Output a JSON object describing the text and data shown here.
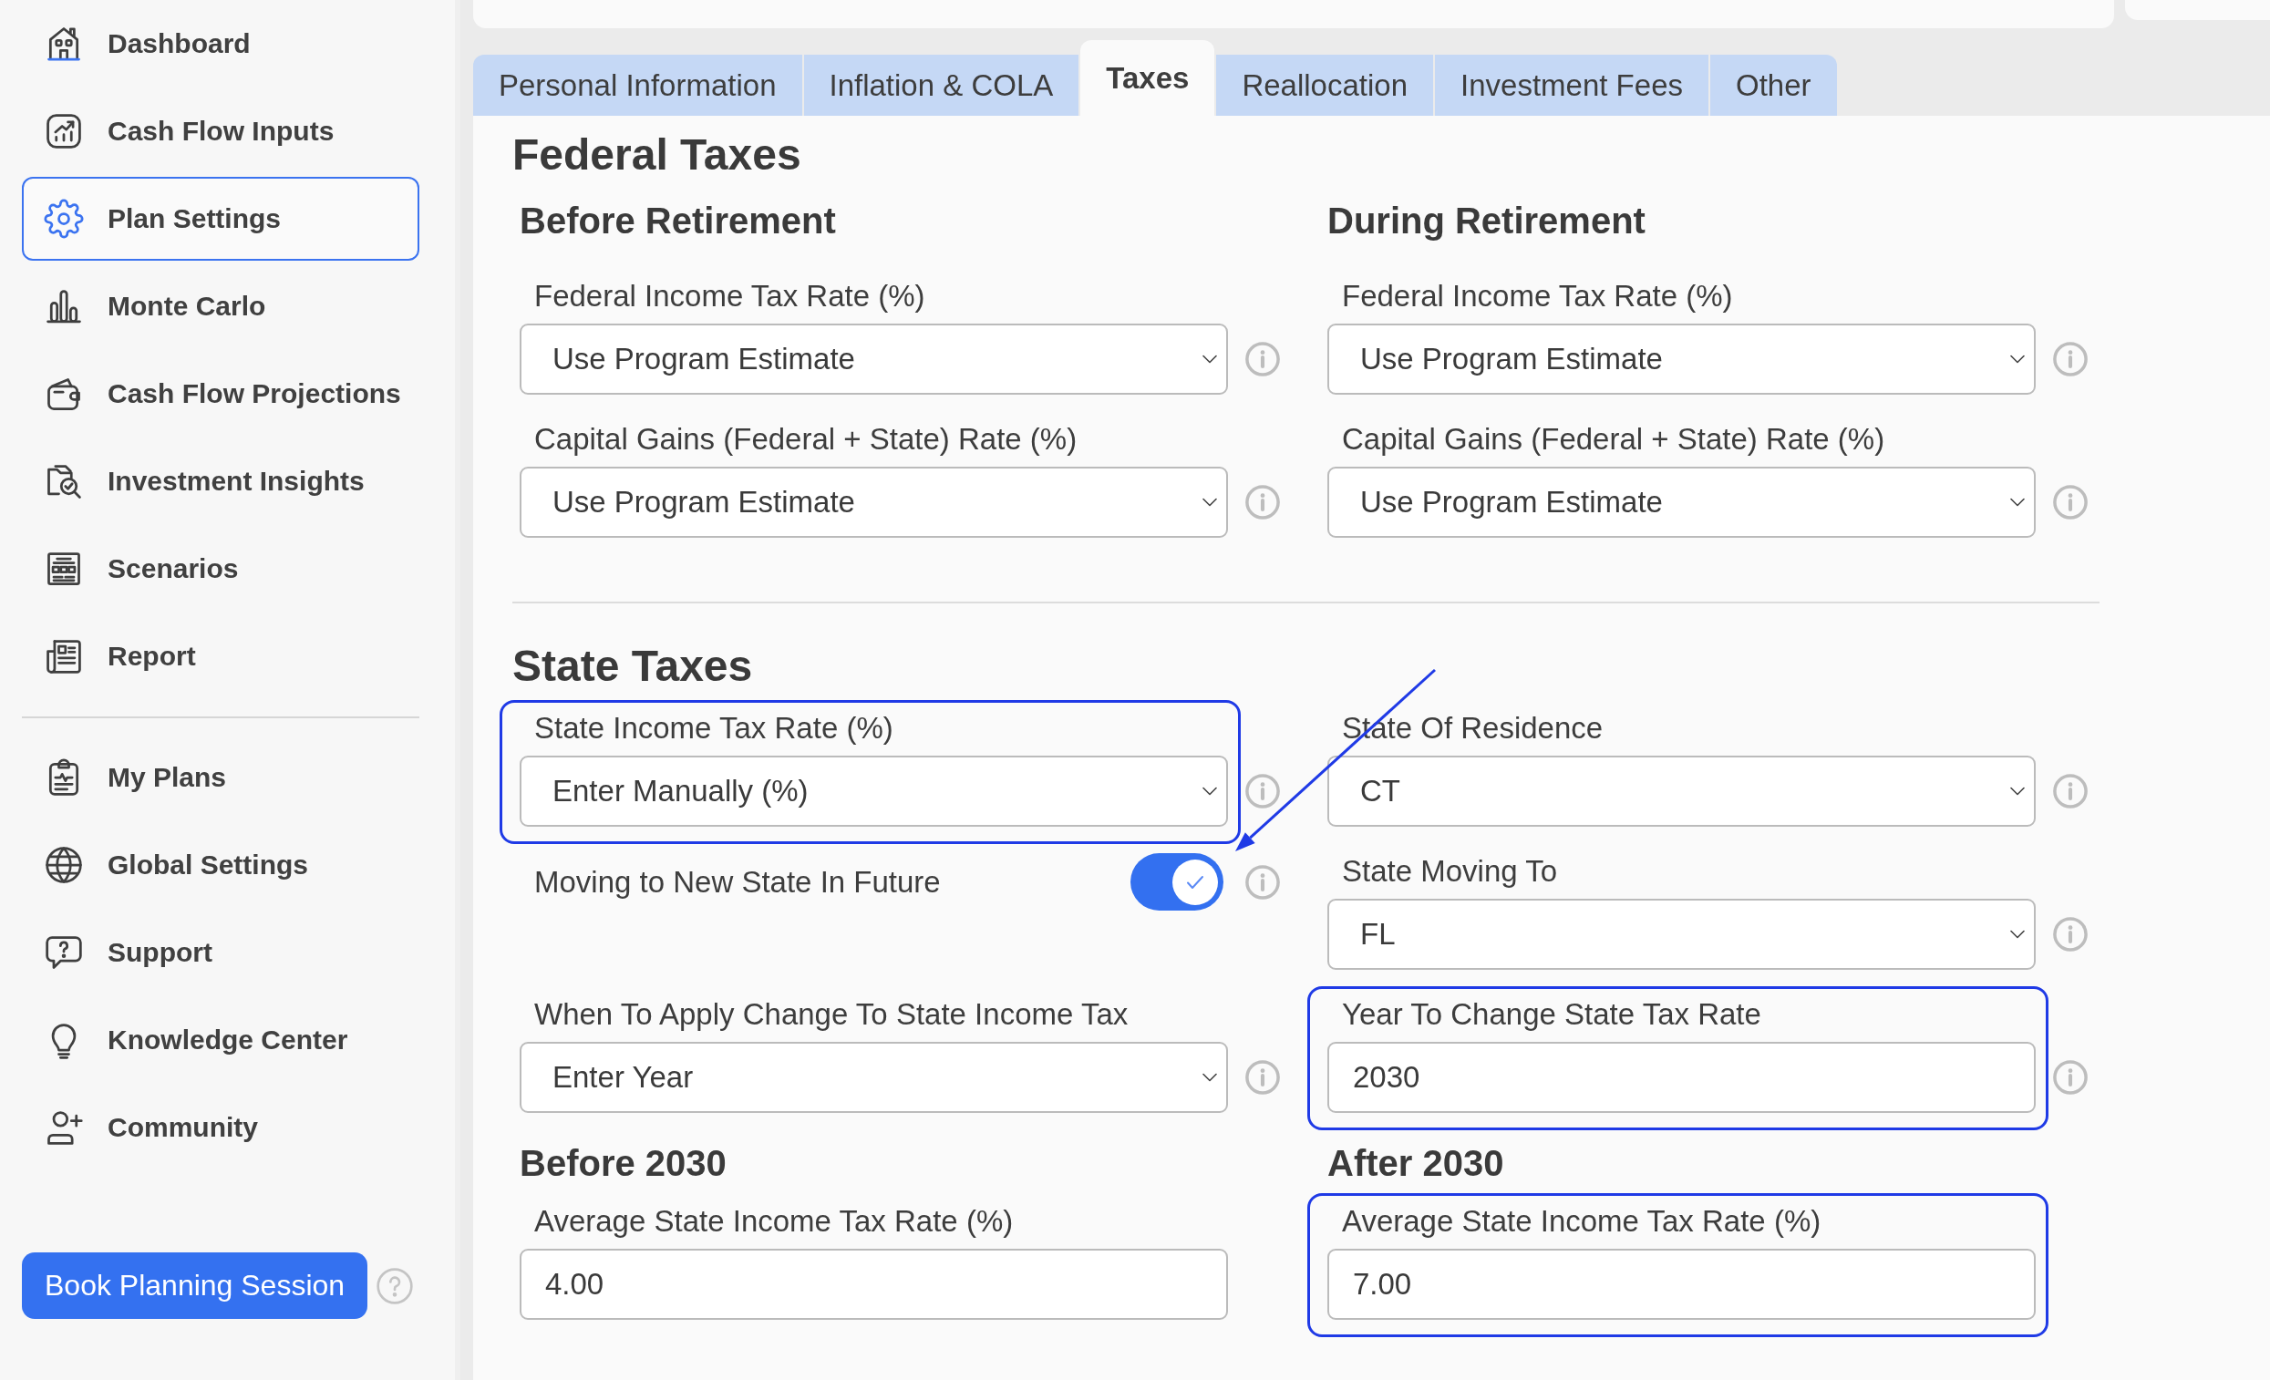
{
  "sidebar": {
    "nav_items": [
      {
        "label": "Dashboard",
        "selected": false
      },
      {
        "label": "Cash Flow Inputs",
        "selected": false
      },
      {
        "label": "Plan Settings",
        "selected": true
      },
      {
        "label": "Monte Carlo",
        "selected": false
      },
      {
        "label": "Cash Flow Projections",
        "selected": false
      },
      {
        "label": "Investment Insights",
        "selected": false
      },
      {
        "label": "Scenarios",
        "selected": false
      },
      {
        "label": "Report",
        "selected": false
      }
    ],
    "account_items": [
      {
        "label": "My Plans",
        "selected": false
      },
      {
        "label": "Global Settings",
        "selected": false
      },
      {
        "label": "Support",
        "selected": false
      },
      {
        "label": "Knowledge Center",
        "selected": false
      },
      {
        "label": "Community",
        "selected": false
      }
    ],
    "book_button": "Book Planning Session"
  },
  "tabs": [
    {
      "label": "Personal Information",
      "selected": false
    },
    {
      "label": "Inflation & COLA",
      "selected": false
    },
    {
      "label": "Taxes",
      "selected": true
    },
    {
      "label": "Reallocation",
      "selected": false
    },
    {
      "label": "Investment Fees",
      "selected": false
    },
    {
      "label": "Other",
      "selected": false
    }
  ],
  "sections": [
    {
      "title": "Federal Taxes",
      "rows": [
        {
          "cells": [
            {
              "kind": "heading",
              "text": "Before Retirement"
            },
            {
              "kind": "heading",
              "text": "During Retirement"
            }
          ]
        },
        {
          "cells": [
            {
              "kind": "select",
              "label": "Federal Income Tax Rate (%)",
              "value": "Use Program Estimate",
              "info": true,
              "highlighted": false
            },
            {
              "kind": "select",
              "label": "Federal Income Tax Rate (%)",
              "value": "Use Program Estimate",
              "info": true,
              "highlighted": false
            }
          ]
        },
        {
          "cells": [
            {
              "kind": "select",
              "label": "Capital Gains (Federal + State) Rate (%)",
              "value": "Use Program Estimate",
              "info": true,
              "highlighted": false
            },
            {
              "kind": "select",
              "label": "Capital Gains (Federal + State) Rate (%)",
              "value": "Use Program Estimate",
              "info": true,
              "highlighted": false
            }
          ]
        }
      ]
    },
    {
      "title": "State Taxes",
      "rows": [
        {
          "cells": [
            {
              "kind": "select",
              "label": "State Income Tax Rate (%)",
              "value": "Enter Manually (%)",
              "info": true,
              "highlighted": true
            },
            {
              "kind": "select",
              "label": "State Of Residence",
              "value": "CT",
              "info": true,
              "highlighted": false
            }
          ]
        },
        {
          "cells": [
            {
              "kind": "toggle",
              "label": "Moving to New State In Future",
              "on": true,
              "info": true,
              "highlighted": false
            },
            {
              "kind": "select",
              "label": "State Moving To",
              "value": "FL",
              "info": true,
              "highlighted": false
            }
          ]
        },
        {
          "cells": [
            {
              "kind": "select",
              "label": "When To Apply Change To State Income Tax",
              "value": "Enter Year",
              "info": true,
              "highlighted": false
            },
            {
              "kind": "input",
              "label": "Year To Change State Tax Rate",
              "value": "2030",
              "info": true,
              "highlighted": true
            }
          ]
        },
        {
          "cells": [
            {
              "kind": "heading",
              "text": "Before 2030"
            },
            {
              "kind": "heading",
              "text": "After 2030"
            }
          ]
        },
        {
          "cells": [
            {
              "kind": "input",
              "label": "Average State Income Tax Rate (%)",
              "value": "4.00",
              "info": false,
              "highlighted": false
            },
            {
              "kind": "input",
              "label": "Average State Income Tax Rate (%)",
              "value": "7.00",
              "info": false,
              "highlighted": true
            }
          ]
        }
      ]
    }
  ]
}
